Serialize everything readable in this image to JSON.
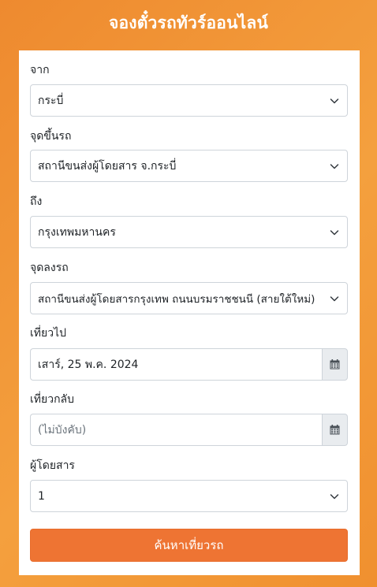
{
  "header": {
    "title": "จองตั๋วรถทัวร์ออนไลน์"
  },
  "form": {
    "from": {
      "label": "จาก",
      "value": "กระบี่",
      "icon": "chevron-down-icon"
    },
    "pickup": {
      "label": "จุดขึ้นรถ",
      "value": "สถานีขนส่งผู้โดยสาร จ.กระบี่",
      "icon": "chevron-down-icon"
    },
    "to": {
      "label": "ถึง",
      "value": "กรุงเทพมหานคร",
      "icon": "chevron-down-icon"
    },
    "dropoff": {
      "label": "จุดลงรถ",
      "value": "สถานีขนส่งผู้โดยสารกรุงเทพ ถนนบรมราชชนนี (สายใต้ใหม่)",
      "icon": "chevron-down-icon"
    },
    "depart": {
      "label": "เที่ยวไป",
      "value": "เสาร์, 25 พ.ค. 2024",
      "icon": "calendar-icon"
    },
    "return": {
      "label": "เที่ยวกลับ",
      "placeholder": "(ไม่บังคับ)",
      "icon": "calendar-icon"
    },
    "passengers": {
      "label": "ผู้โดยสาร",
      "value": "1",
      "icon": "chevron-down-icon"
    },
    "submit_label": "ค้นหาเที่ยวรถ"
  },
  "colors": {
    "background": "#f09a36",
    "button": "#ee7433",
    "addon": "#e9ecef"
  }
}
